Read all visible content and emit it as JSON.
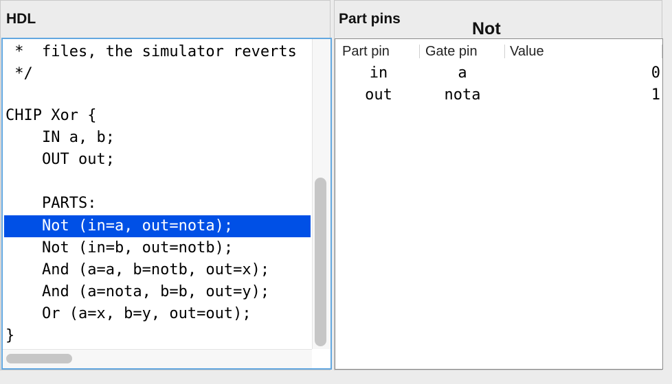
{
  "hdl": {
    "title": "HDL",
    "lines": [
      " *  files, the simulator reverts",
      " */",
      "",
      "CHIP Xor {",
      "    IN a, b;",
      "    OUT out;",
      "",
      "    PARTS:",
      "    Not (in=a, out=nota);",
      "    Not (in=b, out=notb);",
      "    And (a=a, b=notb, out=x);",
      "    And (a=nota, b=b, out=y);",
      "    Or (a=x, b=y, out=out);",
      "}"
    ],
    "selected_line_index": 8
  },
  "part_pins": {
    "title": "Part pins",
    "part_name": "Not",
    "columns": [
      "Part pin",
      "Gate pin",
      "Value"
    ],
    "rows": [
      {
        "part_pin": "in",
        "gate_pin": "a",
        "value": "0"
      },
      {
        "part_pin": "out",
        "gate_pin": "nota",
        "value": "1"
      }
    ]
  },
  "colors": {
    "selection": "#0050e6",
    "focus_border": "#62a7e0",
    "background": "#ececec"
  }
}
